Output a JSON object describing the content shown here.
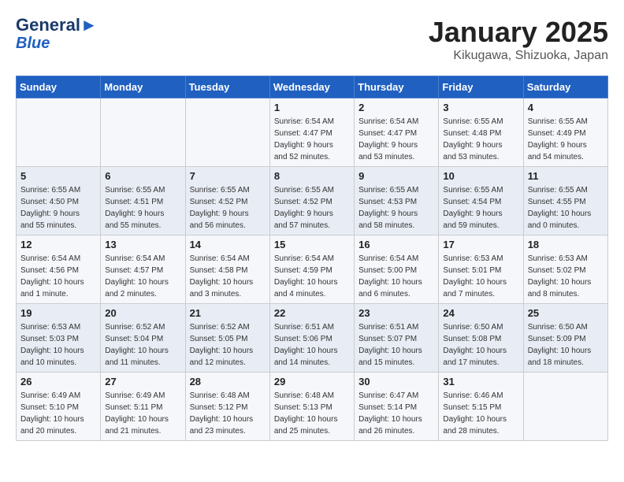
{
  "header": {
    "logo_line1": "General",
    "logo_line2": "Blue",
    "title": "January 2025",
    "subtitle": "Kikugawa, Shizuoka, Japan"
  },
  "weekdays": [
    "Sunday",
    "Monday",
    "Tuesday",
    "Wednesday",
    "Thursday",
    "Friday",
    "Saturday"
  ],
  "weeks": [
    [
      {
        "num": "",
        "info": ""
      },
      {
        "num": "",
        "info": ""
      },
      {
        "num": "",
        "info": ""
      },
      {
        "num": "1",
        "info": "Sunrise: 6:54 AM\nSunset: 4:47 PM\nDaylight: 9 hours\nand 52 minutes."
      },
      {
        "num": "2",
        "info": "Sunrise: 6:54 AM\nSunset: 4:47 PM\nDaylight: 9 hours\nand 53 minutes."
      },
      {
        "num": "3",
        "info": "Sunrise: 6:55 AM\nSunset: 4:48 PM\nDaylight: 9 hours\nand 53 minutes."
      },
      {
        "num": "4",
        "info": "Sunrise: 6:55 AM\nSunset: 4:49 PM\nDaylight: 9 hours\nand 54 minutes."
      }
    ],
    [
      {
        "num": "5",
        "info": "Sunrise: 6:55 AM\nSunset: 4:50 PM\nDaylight: 9 hours\nand 55 minutes."
      },
      {
        "num": "6",
        "info": "Sunrise: 6:55 AM\nSunset: 4:51 PM\nDaylight: 9 hours\nand 55 minutes."
      },
      {
        "num": "7",
        "info": "Sunrise: 6:55 AM\nSunset: 4:52 PM\nDaylight: 9 hours\nand 56 minutes."
      },
      {
        "num": "8",
        "info": "Sunrise: 6:55 AM\nSunset: 4:52 PM\nDaylight: 9 hours\nand 57 minutes."
      },
      {
        "num": "9",
        "info": "Sunrise: 6:55 AM\nSunset: 4:53 PM\nDaylight: 9 hours\nand 58 minutes."
      },
      {
        "num": "10",
        "info": "Sunrise: 6:55 AM\nSunset: 4:54 PM\nDaylight: 9 hours\nand 59 minutes."
      },
      {
        "num": "11",
        "info": "Sunrise: 6:55 AM\nSunset: 4:55 PM\nDaylight: 10 hours\nand 0 minutes."
      }
    ],
    [
      {
        "num": "12",
        "info": "Sunrise: 6:54 AM\nSunset: 4:56 PM\nDaylight: 10 hours\nand 1 minute."
      },
      {
        "num": "13",
        "info": "Sunrise: 6:54 AM\nSunset: 4:57 PM\nDaylight: 10 hours\nand 2 minutes."
      },
      {
        "num": "14",
        "info": "Sunrise: 6:54 AM\nSunset: 4:58 PM\nDaylight: 10 hours\nand 3 minutes."
      },
      {
        "num": "15",
        "info": "Sunrise: 6:54 AM\nSunset: 4:59 PM\nDaylight: 10 hours\nand 4 minutes."
      },
      {
        "num": "16",
        "info": "Sunrise: 6:54 AM\nSunset: 5:00 PM\nDaylight: 10 hours\nand 6 minutes."
      },
      {
        "num": "17",
        "info": "Sunrise: 6:53 AM\nSunset: 5:01 PM\nDaylight: 10 hours\nand 7 minutes."
      },
      {
        "num": "18",
        "info": "Sunrise: 6:53 AM\nSunset: 5:02 PM\nDaylight: 10 hours\nand 8 minutes."
      }
    ],
    [
      {
        "num": "19",
        "info": "Sunrise: 6:53 AM\nSunset: 5:03 PM\nDaylight: 10 hours\nand 10 minutes."
      },
      {
        "num": "20",
        "info": "Sunrise: 6:52 AM\nSunset: 5:04 PM\nDaylight: 10 hours\nand 11 minutes."
      },
      {
        "num": "21",
        "info": "Sunrise: 6:52 AM\nSunset: 5:05 PM\nDaylight: 10 hours\nand 12 minutes."
      },
      {
        "num": "22",
        "info": "Sunrise: 6:51 AM\nSunset: 5:06 PM\nDaylight: 10 hours\nand 14 minutes."
      },
      {
        "num": "23",
        "info": "Sunrise: 6:51 AM\nSunset: 5:07 PM\nDaylight: 10 hours\nand 15 minutes."
      },
      {
        "num": "24",
        "info": "Sunrise: 6:50 AM\nSunset: 5:08 PM\nDaylight: 10 hours\nand 17 minutes."
      },
      {
        "num": "25",
        "info": "Sunrise: 6:50 AM\nSunset: 5:09 PM\nDaylight: 10 hours\nand 18 minutes."
      }
    ],
    [
      {
        "num": "26",
        "info": "Sunrise: 6:49 AM\nSunset: 5:10 PM\nDaylight: 10 hours\nand 20 minutes."
      },
      {
        "num": "27",
        "info": "Sunrise: 6:49 AM\nSunset: 5:11 PM\nDaylight: 10 hours\nand 21 minutes."
      },
      {
        "num": "28",
        "info": "Sunrise: 6:48 AM\nSunset: 5:12 PM\nDaylight: 10 hours\nand 23 minutes."
      },
      {
        "num": "29",
        "info": "Sunrise: 6:48 AM\nSunset: 5:13 PM\nDaylight: 10 hours\nand 25 minutes."
      },
      {
        "num": "30",
        "info": "Sunrise: 6:47 AM\nSunset: 5:14 PM\nDaylight: 10 hours\nand 26 minutes."
      },
      {
        "num": "31",
        "info": "Sunrise: 6:46 AM\nSunset: 5:15 PM\nDaylight: 10 hours\nand 28 minutes."
      },
      {
        "num": "",
        "info": ""
      }
    ]
  ]
}
